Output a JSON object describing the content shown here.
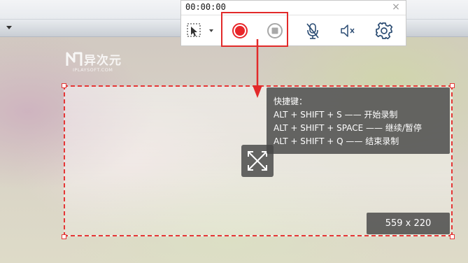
{
  "recorder": {
    "timer": "00:00:00",
    "close_glyph": "×",
    "buttons": [
      {
        "name": "region-select-icon",
        "label": ""
      },
      {
        "name": "record-icon",
        "color": "#e8262a"
      },
      {
        "name": "stop-icon",
        "color": "#b0b0b0"
      },
      {
        "name": "microphone-muted-icon"
      },
      {
        "name": "speaker-muted-icon"
      },
      {
        "name": "gear-icon"
      }
    ]
  },
  "watermark": {
    "title": "异次元",
    "subtitle": "IPLAYSOFT.COM"
  },
  "hotkeys": {
    "title": "快捷键：",
    "lines": [
      "ALT + SHIFT + S —— 开始录制",
      "ALT + SHIFT + SPACE —— 继续/暂停",
      "ALT + SHIFT + Q —— 结束录制"
    ]
  },
  "selection": {
    "size_label": "559 x 220",
    "border_color": "#e53636"
  },
  "colors": {
    "accent_red": "#e22a2a",
    "overlay": "#464646"
  }
}
